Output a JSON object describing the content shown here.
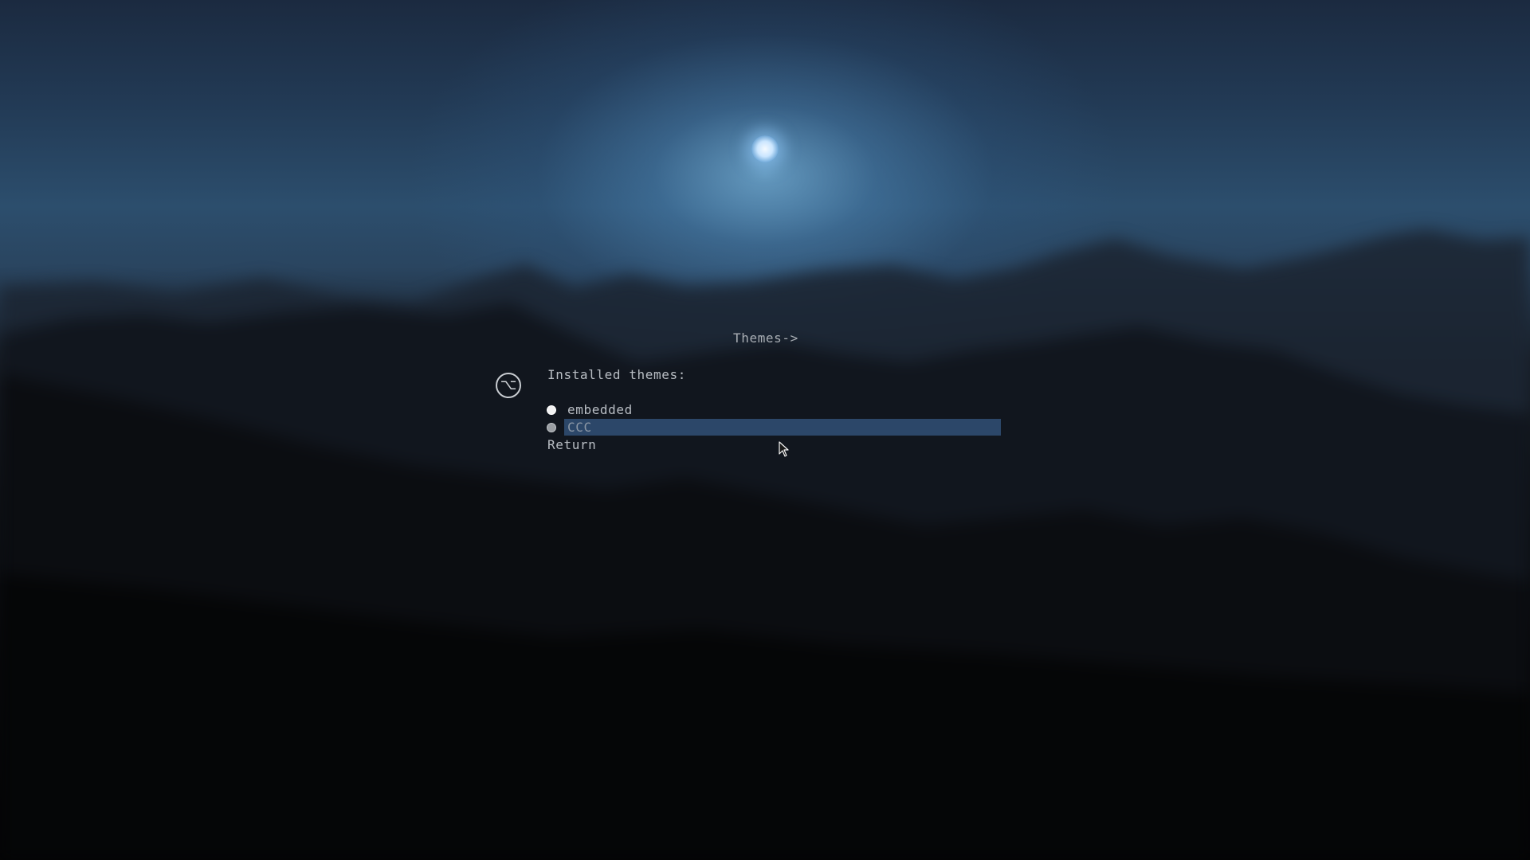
{
  "menu": {
    "title": "Themes->",
    "section_label": "Installed themes:",
    "app_icon_glyph": "⌥",
    "themes": [
      {
        "label": "embedded",
        "selected": true
      },
      {
        "label": "CCC",
        "selected": false,
        "highlighted": true
      }
    ],
    "return_label": "Return"
  },
  "icons": {
    "app": "option-key-icon",
    "cursor": "mouse-pointer-icon"
  },
  "colors": {
    "highlight": "#2c4769",
    "text": "#b9bec4",
    "background_top": "#1b2a40",
    "background_bottom": "#030304"
  }
}
